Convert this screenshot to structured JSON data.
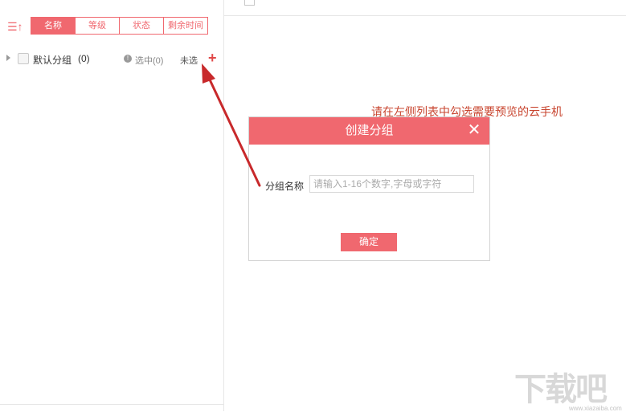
{
  "sidebar": {
    "sort_icon": "sort-up-icon",
    "tabs": [
      {
        "label": "名称",
        "active": true
      },
      {
        "label": "等级",
        "active": false
      },
      {
        "label": "状态",
        "active": false
      },
      {
        "label": "剩余时间",
        "active": false
      }
    ],
    "group": {
      "name": "默认分组",
      "count": "(0)",
      "selected": "选中(0)",
      "unselected": "未选",
      "add": "+"
    }
  },
  "main": {
    "top_partial": "",
    "hint": "请在左侧列表中勾选需要预览的云手机"
  },
  "dialog": {
    "title": "创建分组",
    "close": "✕",
    "field_label": "分组名称",
    "field_placeholder": "请输入1-16个数字,字母或字符",
    "field_value": "",
    "confirm_label": "确定"
  },
  "watermark": {
    "text": "下载吧",
    "sub": "www.xiazaiba.com"
  },
  "colors": {
    "accent": "#f0686f",
    "arrow": "#c8292b",
    "hint": "#c8452f"
  }
}
